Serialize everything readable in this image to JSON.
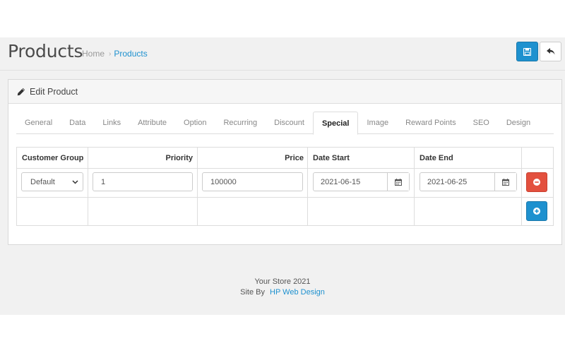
{
  "page": {
    "title": "Products",
    "breadcrumb": [
      "Home",
      "Products"
    ],
    "breadcrumb_separator": "›"
  },
  "header_buttons": {
    "save_icon": "floppy-disk-icon",
    "back_icon": "reply-arrow-icon",
    "save_color": "#1e91cf"
  },
  "panel": {
    "title": "Edit Product",
    "icon": "pencil-icon"
  },
  "tabs": [
    {
      "label": "General"
    },
    {
      "label": "Data"
    },
    {
      "label": "Links"
    },
    {
      "label": "Attribute"
    },
    {
      "label": "Option"
    },
    {
      "label": "Recurring"
    },
    {
      "label": "Discount"
    },
    {
      "label": "Special",
      "active": true
    },
    {
      "label": "Image"
    },
    {
      "label": "Reward Points"
    },
    {
      "label": "SEO"
    },
    {
      "label": "Design"
    }
  ],
  "special_table": {
    "columns": [
      "Customer Group",
      "Priority",
      "Price",
      "Date Start",
      "Date End"
    ],
    "rows": [
      {
        "customer_group": "Default",
        "priority": "1",
        "price": "100000",
        "date_start": "2021-06-15",
        "date_end": "2021-06-25"
      }
    ],
    "remove_icon": "minus-circle-icon",
    "add_icon": "plus-circle-icon",
    "remove_color": "#e3503e",
    "add_color": "#1e91cf"
  },
  "footer": {
    "line1": "Your Store 2021",
    "prefix": "Site By",
    "link": "HP Web Design"
  }
}
